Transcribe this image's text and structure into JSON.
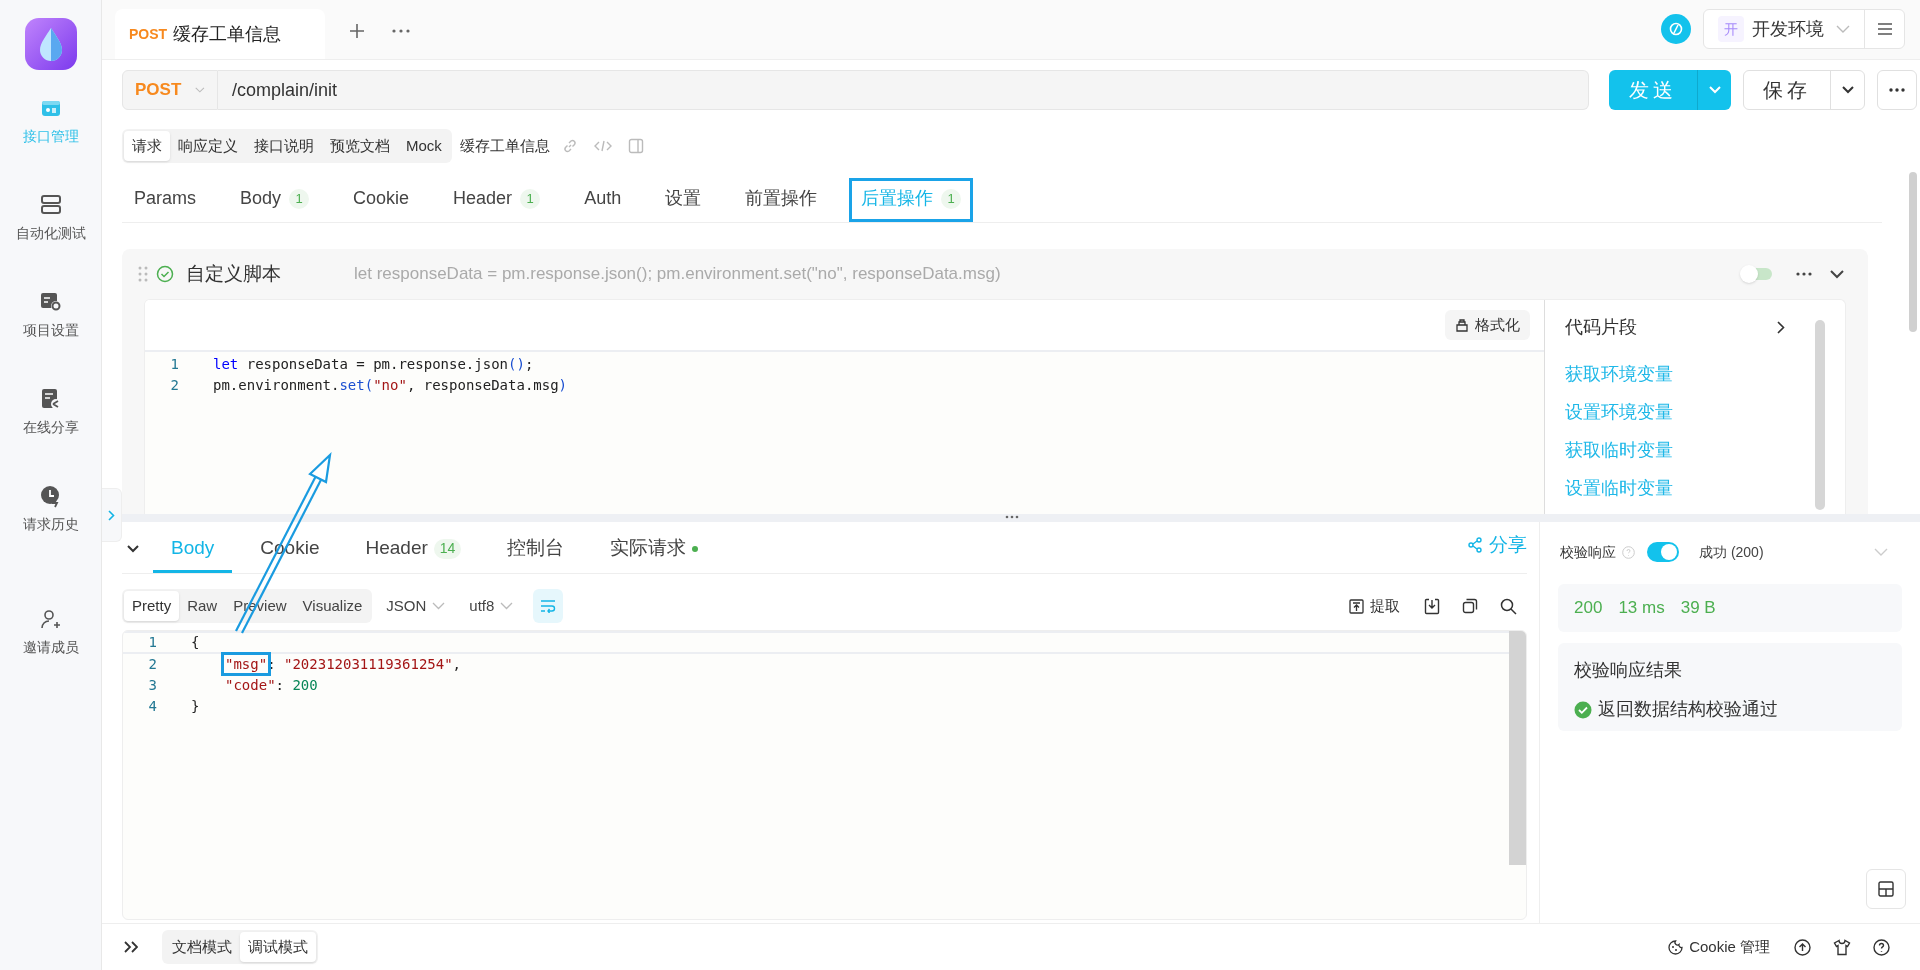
{
  "sidebar": {
    "items": [
      {
        "label": "接口管理",
        "selected": true
      },
      {
        "label": "自动化测试",
        "selected": false
      },
      {
        "label": "项目设置",
        "selected": false
      },
      {
        "label": "在线分享",
        "selected": false
      },
      {
        "label": "请求历史",
        "selected": false
      },
      {
        "label": "邀请成员",
        "selected": false
      }
    ]
  },
  "doc_tabs": [
    {
      "method": "POST",
      "title": "缓存工单信息"
    }
  ],
  "environment": {
    "badge": "开",
    "name": "开发环境"
  },
  "request": {
    "method": "POST",
    "url": "/complain/init",
    "send": "发送",
    "save": "保存"
  },
  "view_tabs": [
    {
      "label": "请求",
      "selected": true
    },
    {
      "label": "响应定义",
      "selected": false
    },
    {
      "label": "接口说明",
      "selected": false
    },
    {
      "label": "预览文档",
      "selected": false
    },
    {
      "label": "Mock",
      "selected": false
    }
  ],
  "api_name": "缓存工单信息",
  "param_tabs": [
    {
      "label": "Params",
      "selected": false,
      "highlighted": false
    },
    {
      "label": "Body",
      "count": "1",
      "selected": false,
      "highlighted": false
    },
    {
      "label": "Cookie",
      "selected": false,
      "highlighted": false
    },
    {
      "label": "Header",
      "count": "1",
      "selected": false,
      "highlighted": false
    },
    {
      "label": "Auth",
      "selected": false,
      "highlighted": false
    },
    {
      "label": "设置",
      "selected": false,
      "highlighted": false
    },
    {
      "label": "前置操作",
      "selected": false,
      "highlighted": false
    },
    {
      "label": "后置操作",
      "count": "1",
      "selected": true,
      "highlighted": true
    }
  ],
  "script": {
    "title": "自定义脚本",
    "preview": "let responseData = pm.response.json(); pm.environment.set(\"no\", responseData.msg)",
    "enabled": false,
    "format": "格式化",
    "lines": [
      {
        "number": "1",
        "indented": false,
        "tokens": [
          {
            "text": "let",
            "kind": "keyword"
          },
          {
            "text": " responseData = pm.response.json",
            "kind": "plain"
          },
          {
            "text": "()",
            "kind": "bracket"
          },
          {
            "text": ";",
            "kind": "plain"
          }
        ]
      },
      {
        "number": "2",
        "indented": false,
        "tokens": [
          {
            "text": "pm.environment.",
            "kind": "plain"
          },
          {
            "text": "set(",
            "kind": "bracket"
          },
          {
            "text": "\"no\"",
            "kind": "string"
          },
          {
            "text": ", responseData.msg",
            "kind": "plain"
          },
          {
            "text": ")",
            "kind": "bracket"
          }
        ]
      }
    ]
  },
  "snippets": {
    "title": "代码片段",
    "items": [
      "获取环境变量",
      "设置环境变量",
      "获取临时变量",
      "设置临时变量"
    ]
  },
  "response_tabs": [
    {
      "label": "Body",
      "dot": false,
      "selected": true
    },
    {
      "label": "Cookie",
      "dot": false,
      "selected": false
    },
    {
      "label": "Header",
      "count": "14",
      "dot": false,
      "selected": false
    },
    {
      "label": "控制台",
      "dot": false,
      "selected": false
    },
    {
      "label": "实际请求",
      "dot": true,
      "selected": false
    }
  ],
  "share": "分享",
  "format_tabs": [
    {
      "label": "Pretty",
      "selected": true
    },
    {
      "label": "Raw",
      "selected": false
    },
    {
      "label": "Preview",
      "selected": false
    },
    {
      "label": "Visualize",
      "selected": false
    }
  ],
  "format": "JSON",
  "encoding": "utf8",
  "extract": "提取",
  "body_lines": [
    {
      "number": "1",
      "indented": false,
      "tokens": [
        {
          "text": "{",
          "kind": "punct"
        }
      ]
    },
    {
      "number": "2",
      "indented": true,
      "tokens": [
        {
          "text": "\"msg\"",
          "kind": "key",
          "highlighted": true
        },
        {
          "text": ": ",
          "kind": "punct"
        },
        {
          "text": "\"202312031119361254\"",
          "kind": "string"
        },
        {
          "text": ",",
          "kind": "punct"
        }
      ]
    },
    {
      "number": "3",
      "indented": true,
      "tokens": [
        {
          "text": "\"code\"",
          "kind": "key"
        },
        {
          "text": ": ",
          "kind": "punct"
        },
        {
          "text": "200",
          "kind": "number"
        }
      ]
    },
    {
      "number": "4",
      "indented": false,
      "tokens": [
        {
          "text": "}",
          "kind": "punct"
        }
      ]
    }
  ],
  "validation": {
    "label": "校验响应",
    "enabled": true,
    "result": "成功 (200)",
    "status": "200",
    "time": "13 ms",
    "size": "39 B",
    "title": "校验响应结果",
    "message": "返回数据结构校验通过"
  },
  "modes": [
    {
      "label": "文档模式",
      "selected": false
    },
    {
      "label": "调试模式",
      "selected": true
    }
  ],
  "cookie_manager": "Cookie 管理"
}
